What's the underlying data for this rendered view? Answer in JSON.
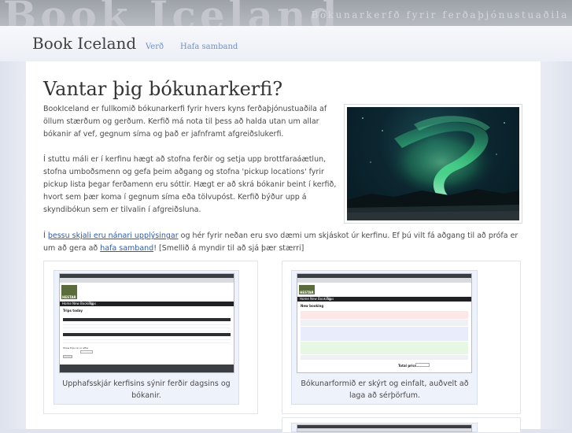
{
  "banner": {
    "big_text": "Book Iceland",
    "tagline": "Bókunarkerfð fyrir ferðaþjónustuaðila"
  },
  "header": {
    "site_title": "Book Iceland",
    "nav": [
      {
        "label": "Verð"
      },
      {
        "label": "Hafa samband"
      }
    ]
  },
  "main": {
    "heading": "Vantar þig bókunarkerfi?",
    "paragraph1": "BookIceland er fullkomið bókunarkerfi fyrir hvers kyns ferðaþjónustuaðila af öllum stærðum og gerðum. Kerfið má nota til þess að halda utan um allar bókanir af vef, gegnum síma og það er jafnframt afgreiðslukerfi.",
    "paragraph2": "Í stuttu máli er í kerfinu hægt að stofna ferðir og setja upp brottfaraáætlun, stofna umboðsmenn og gefa þeim aðgang og stofna 'pickup locations' fyrir pickup lista þegar ferðamenn eru sóttir. Hægt er að skrá bókanir beint í kerfið, hvort sem þær koma í gegnum síma eða tölvupóst. Kerfið býður upp á skyndibókun sem er tilvalin í afgreiðsluna.",
    "paragraph3": {
      "prefix": "Í ",
      "link1": "þessu skjali eru nánari upplýsingar",
      "middle": " og hér fyrir neðan eru svo dæmi um skjáskot úr kerfinu. Ef þú vilt fá aðgang til að prófa er um að gera að ",
      "link2": "hafa samband",
      "suffix": "! [Smellið á myndir til að sjá þær stærri]"
    },
    "image_alt": "Norðurljós"
  },
  "gallery": [
    {
      "caption": "Upphafsskjár kerfisins sýnir ferðir dagsins og bókanir.",
      "mini": {
        "brand": "HESTAR",
        "nav": [
          "Home",
          "New Booking",
          "Trips"
        ],
        "section": "Trips today",
        "footer_label": "Show trips on or after"
      }
    },
    {
      "caption": "Bókunarformið er skýrt og einfalt, auðvelt að laga að sérþörfum.",
      "mini": {
        "brand": "HESTAR",
        "nav": [
          "Home",
          "New Booking",
          "Trips"
        ],
        "section": "New booking",
        "total_label": "Total price:"
      }
    }
  ],
  "colors": {
    "link": "#2b59b3",
    "nav_link": "#6f90c4",
    "banner": "#9da1a8"
  }
}
